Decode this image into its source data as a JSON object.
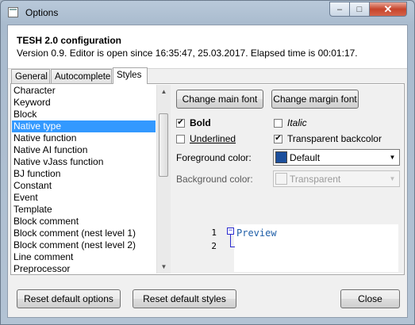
{
  "window": {
    "title": "Options",
    "minimize": "–",
    "maximize": "□",
    "close": "✕"
  },
  "header": {
    "title": "TESH 2.0 configuration",
    "subtitle": "Version 0.9. Editor is open since 16:35:47, 25.03.2017. Elapsed time is 00:01:17."
  },
  "tabs": [
    {
      "label": "General"
    },
    {
      "label": "Autocomplete"
    },
    {
      "label": "Styles"
    }
  ],
  "styles_list": {
    "items": [
      "Character",
      "Keyword",
      "Block",
      "Native type",
      "Native function",
      "Native AI function",
      "Native vJass function",
      "BJ function",
      "Constant",
      "Event",
      "Template",
      "Block comment",
      "Block comment (nest level 1)",
      "Block comment (nest level 2)",
      "Line comment",
      "Preprocessor"
    ],
    "selected": "Native type"
  },
  "font_buttons": {
    "main": "Change main font",
    "margin": "Change margin font"
  },
  "options": {
    "bold": {
      "label": "Bold",
      "checked": true
    },
    "italic": {
      "label": "Italic",
      "checked": false
    },
    "underlined": {
      "label": "Underlined",
      "checked": false
    },
    "transparent": {
      "label": "Transparent backcolor",
      "checked": true
    }
  },
  "foreground": {
    "label": "Foreground color:",
    "value": "Default",
    "color": "#1c4f9c"
  },
  "background": {
    "label": "Background color:",
    "value": "Transparent",
    "color": "#f4f4f4"
  },
  "preview": {
    "line1": "1",
    "line2": "2",
    "text": "Preview",
    "fold_glyph": "−"
  },
  "footer": {
    "reset_options": "Reset default options",
    "reset_styles": "Reset default styles",
    "close": "Close"
  },
  "icons": {
    "check": "✔",
    "arrow_down": "▼",
    "arrow_up": "▲"
  }
}
